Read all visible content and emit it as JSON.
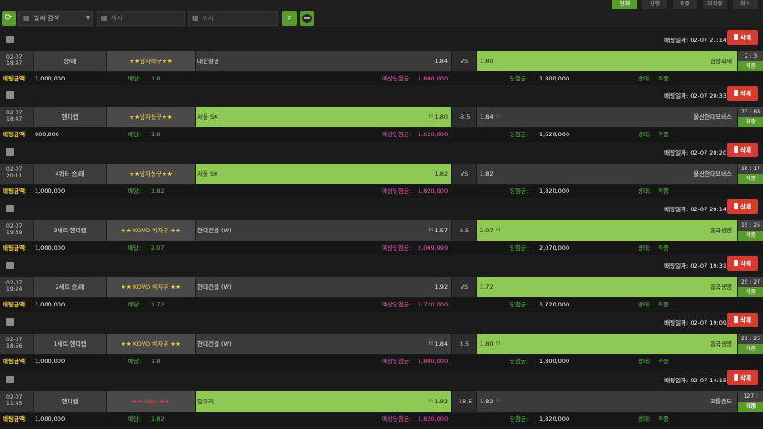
{
  "toolbar": {
    "date_select_label": "날짜 검색",
    "start_placeholder": "개시",
    "end_placeholder": "까지",
    "tabs": [
      "전체",
      "진행",
      "적중",
      "미적중",
      "취소"
    ]
  },
  "labels": {
    "delete": "삭제",
    "bet_date_prefix": "배팅일자:",
    "amount": "배팅금액:",
    "odds": "배당:",
    "expected": "예상당첨금:",
    "won": "당첨금:",
    "status": "상태:"
  },
  "bets": [
    {
      "bet_date": "02-07 21:14",
      "date": "02-07",
      "time": "18:47",
      "type": "승/패",
      "league": "★★남자배구★★",
      "league_red": false,
      "home": "대한항공",
      "home_odd": "1.84",
      "home_win": false,
      "home_h": false,
      "mid": "VS",
      "away_odd": "1.80",
      "away": "삼성화재",
      "away_win": true,
      "away_h": false,
      "score": "2 : 3",
      "result": "적중",
      "amount": "1,000,000",
      "odds": "1.8",
      "expected": "1,800,000",
      "won": "1,800,000",
      "status": "적중"
    },
    {
      "bet_date": "02-07 20:33",
      "date": "02-07",
      "time": "18:47",
      "type": "핸디캡",
      "league": "★★남자농구★★",
      "league_red": false,
      "home": "서울 SK",
      "home_odd": "1.80",
      "home_win": true,
      "home_h": true,
      "mid": "-3.5",
      "away_odd": "1.84",
      "away": "울산현대모비스",
      "away_win": false,
      "away_h": true,
      "score": "73 : 68",
      "result": "적중",
      "amount": "900,000",
      "odds": "1.8",
      "expected": "1,620,000",
      "won": "1,620,000",
      "status": "적중"
    },
    {
      "bet_date": "02-07 20:20",
      "date": "02-07",
      "time": "20:11",
      "type": "4쿼터 승/패",
      "league": "★★남자농구★★",
      "league_red": false,
      "home": "서울 SK",
      "home_odd": "1.82",
      "home_win": true,
      "home_h": false,
      "mid": "VS",
      "away_odd": "1.82",
      "away": "울산현대모비스",
      "away_win": false,
      "away_h": false,
      "score": "18 : 17",
      "result": "적중",
      "amount": "1,000,000",
      "odds": "1.82",
      "expected": "1,820,000",
      "won": "1,820,000",
      "status": "적중"
    },
    {
      "bet_date": "02-07 20:14",
      "date": "02-07",
      "time": "19:59",
      "type": "3세트 핸디캡",
      "league": "★★ KOVO 여자부 ★★",
      "league_red": false,
      "home": "현대건설 (W)",
      "home_odd": "1.57",
      "home_win": false,
      "home_h": true,
      "mid": "2.5",
      "away_odd": "2.07",
      "away": "흥국생명",
      "away_win": true,
      "away_h": true,
      "score": "15 : 25",
      "result": "적중",
      "amount": "1,000,000",
      "odds": "2.07",
      "expected": "2,069,999",
      "won": "2,070,000",
      "status": "적중"
    },
    {
      "bet_date": "02-07 19:31",
      "date": "02-07",
      "time": "19:24",
      "type": "2세트 승/패",
      "league": "★★ KOVO 여자부 ★★",
      "league_red": false,
      "home": "현대건설 (W)",
      "home_odd": "1.92",
      "home_win": false,
      "home_h": false,
      "mid": "VS",
      "away_odd": "1.72",
      "away": "흥국생명",
      "away_win": true,
      "away_h": false,
      "score": "25 : 27",
      "result": "적중",
      "amount": "1,000,000",
      "odds": "1.72",
      "expected": "1,720,000",
      "won": "1,720,000",
      "status": "적중"
    },
    {
      "bet_date": "02-07 19:09",
      "date": "02-07",
      "time": "18:56",
      "type": "1세트 핸디캡",
      "league": "★★ KOVO 여자부 ★★",
      "league_red": false,
      "home": "현대건설 (W)",
      "home_odd": "1.84",
      "home_win": false,
      "home_h": true,
      "mid": "3.5",
      "away_odd": "1.80",
      "away": "흥국생명",
      "away_win": true,
      "away_h": true,
      "score": "21 : 25",
      "result": "적중",
      "amount": "1,000,000",
      "odds": "1.8",
      "expected": "1,800,000",
      "won": "1,800,000",
      "status": "적중"
    },
    {
      "bet_date": "02-07 14:15",
      "date": "02-07",
      "time": "11:45",
      "type": "핸디캡",
      "league": "★★ NBA ★★",
      "league_red": true,
      "home": "밀워키",
      "home_odd": "1.82",
      "home_win": true,
      "home_h": true,
      "mid": "-18.5",
      "away_odd": "1.82",
      "away": "포틀랜드",
      "away_win": false,
      "away_h": true,
      "score": "127 : 108",
      "result": "적중",
      "amount": "1,000,000",
      "odds": "1.82",
      "expected": "1,820,000",
      "won": "1,820,000",
      "status": "적중"
    }
  ]
}
